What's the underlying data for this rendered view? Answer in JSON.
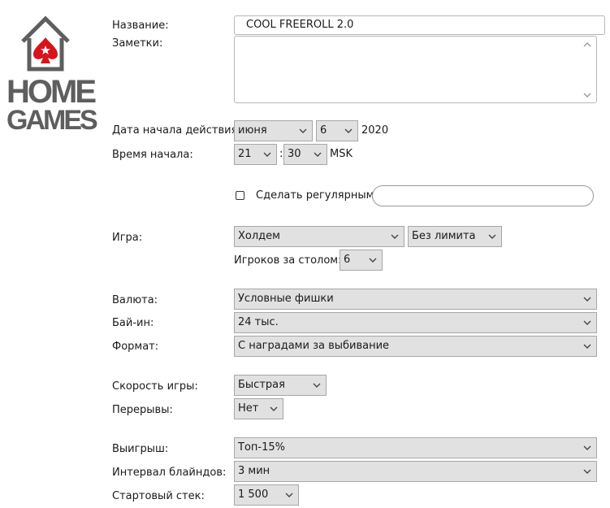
{
  "logo": {
    "line1": "HOME",
    "line2": "GAMES"
  },
  "name_field": {
    "label": "Название:",
    "value": "COOL FREEROLL 2.0"
  },
  "notes_field": {
    "label": "Заметки:",
    "value": ""
  },
  "start_date": {
    "label": "Дата начала действия:",
    "month": "июня",
    "day": "6",
    "year": "2020"
  },
  "start_time": {
    "label": "Время начала:",
    "hour": "21",
    "separator": ":",
    "minute": "30",
    "tz": "MSK"
  },
  "recurring": {
    "label": "Сделать регулярным",
    "checked": false,
    "value": ""
  },
  "game": {
    "label": "Игра:",
    "type": "Холдем",
    "limit": "Без лимита",
    "players_label": "Игроков за столом:",
    "players": "6"
  },
  "currency": {
    "label": "Валюта:",
    "value": "Условные фишки"
  },
  "buyin": {
    "label": "Бай-ин:",
    "value": "24 тыс."
  },
  "format": {
    "label": "Формат:",
    "value": "С наградами за выбивание"
  },
  "speed": {
    "label": "Скорость игры:",
    "value": "Быстрая"
  },
  "breaks": {
    "label": "Перерывы:",
    "value": "Нет"
  },
  "payout": {
    "label": "Выигрыш:",
    "value": "Топ-15%"
  },
  "blinds": {
    "label": "Интервал блайндов:",
    "value": "3 мин"
  },
  "stack": {
    "label": "Стартовый стек:",
    "value": "1 500"
  },
  "colors": {
    "brand_red": "#d7131b",
    "logo_gray": "#5e5e5e",
    "select_bg": "#e1e1e1"
  }
}
